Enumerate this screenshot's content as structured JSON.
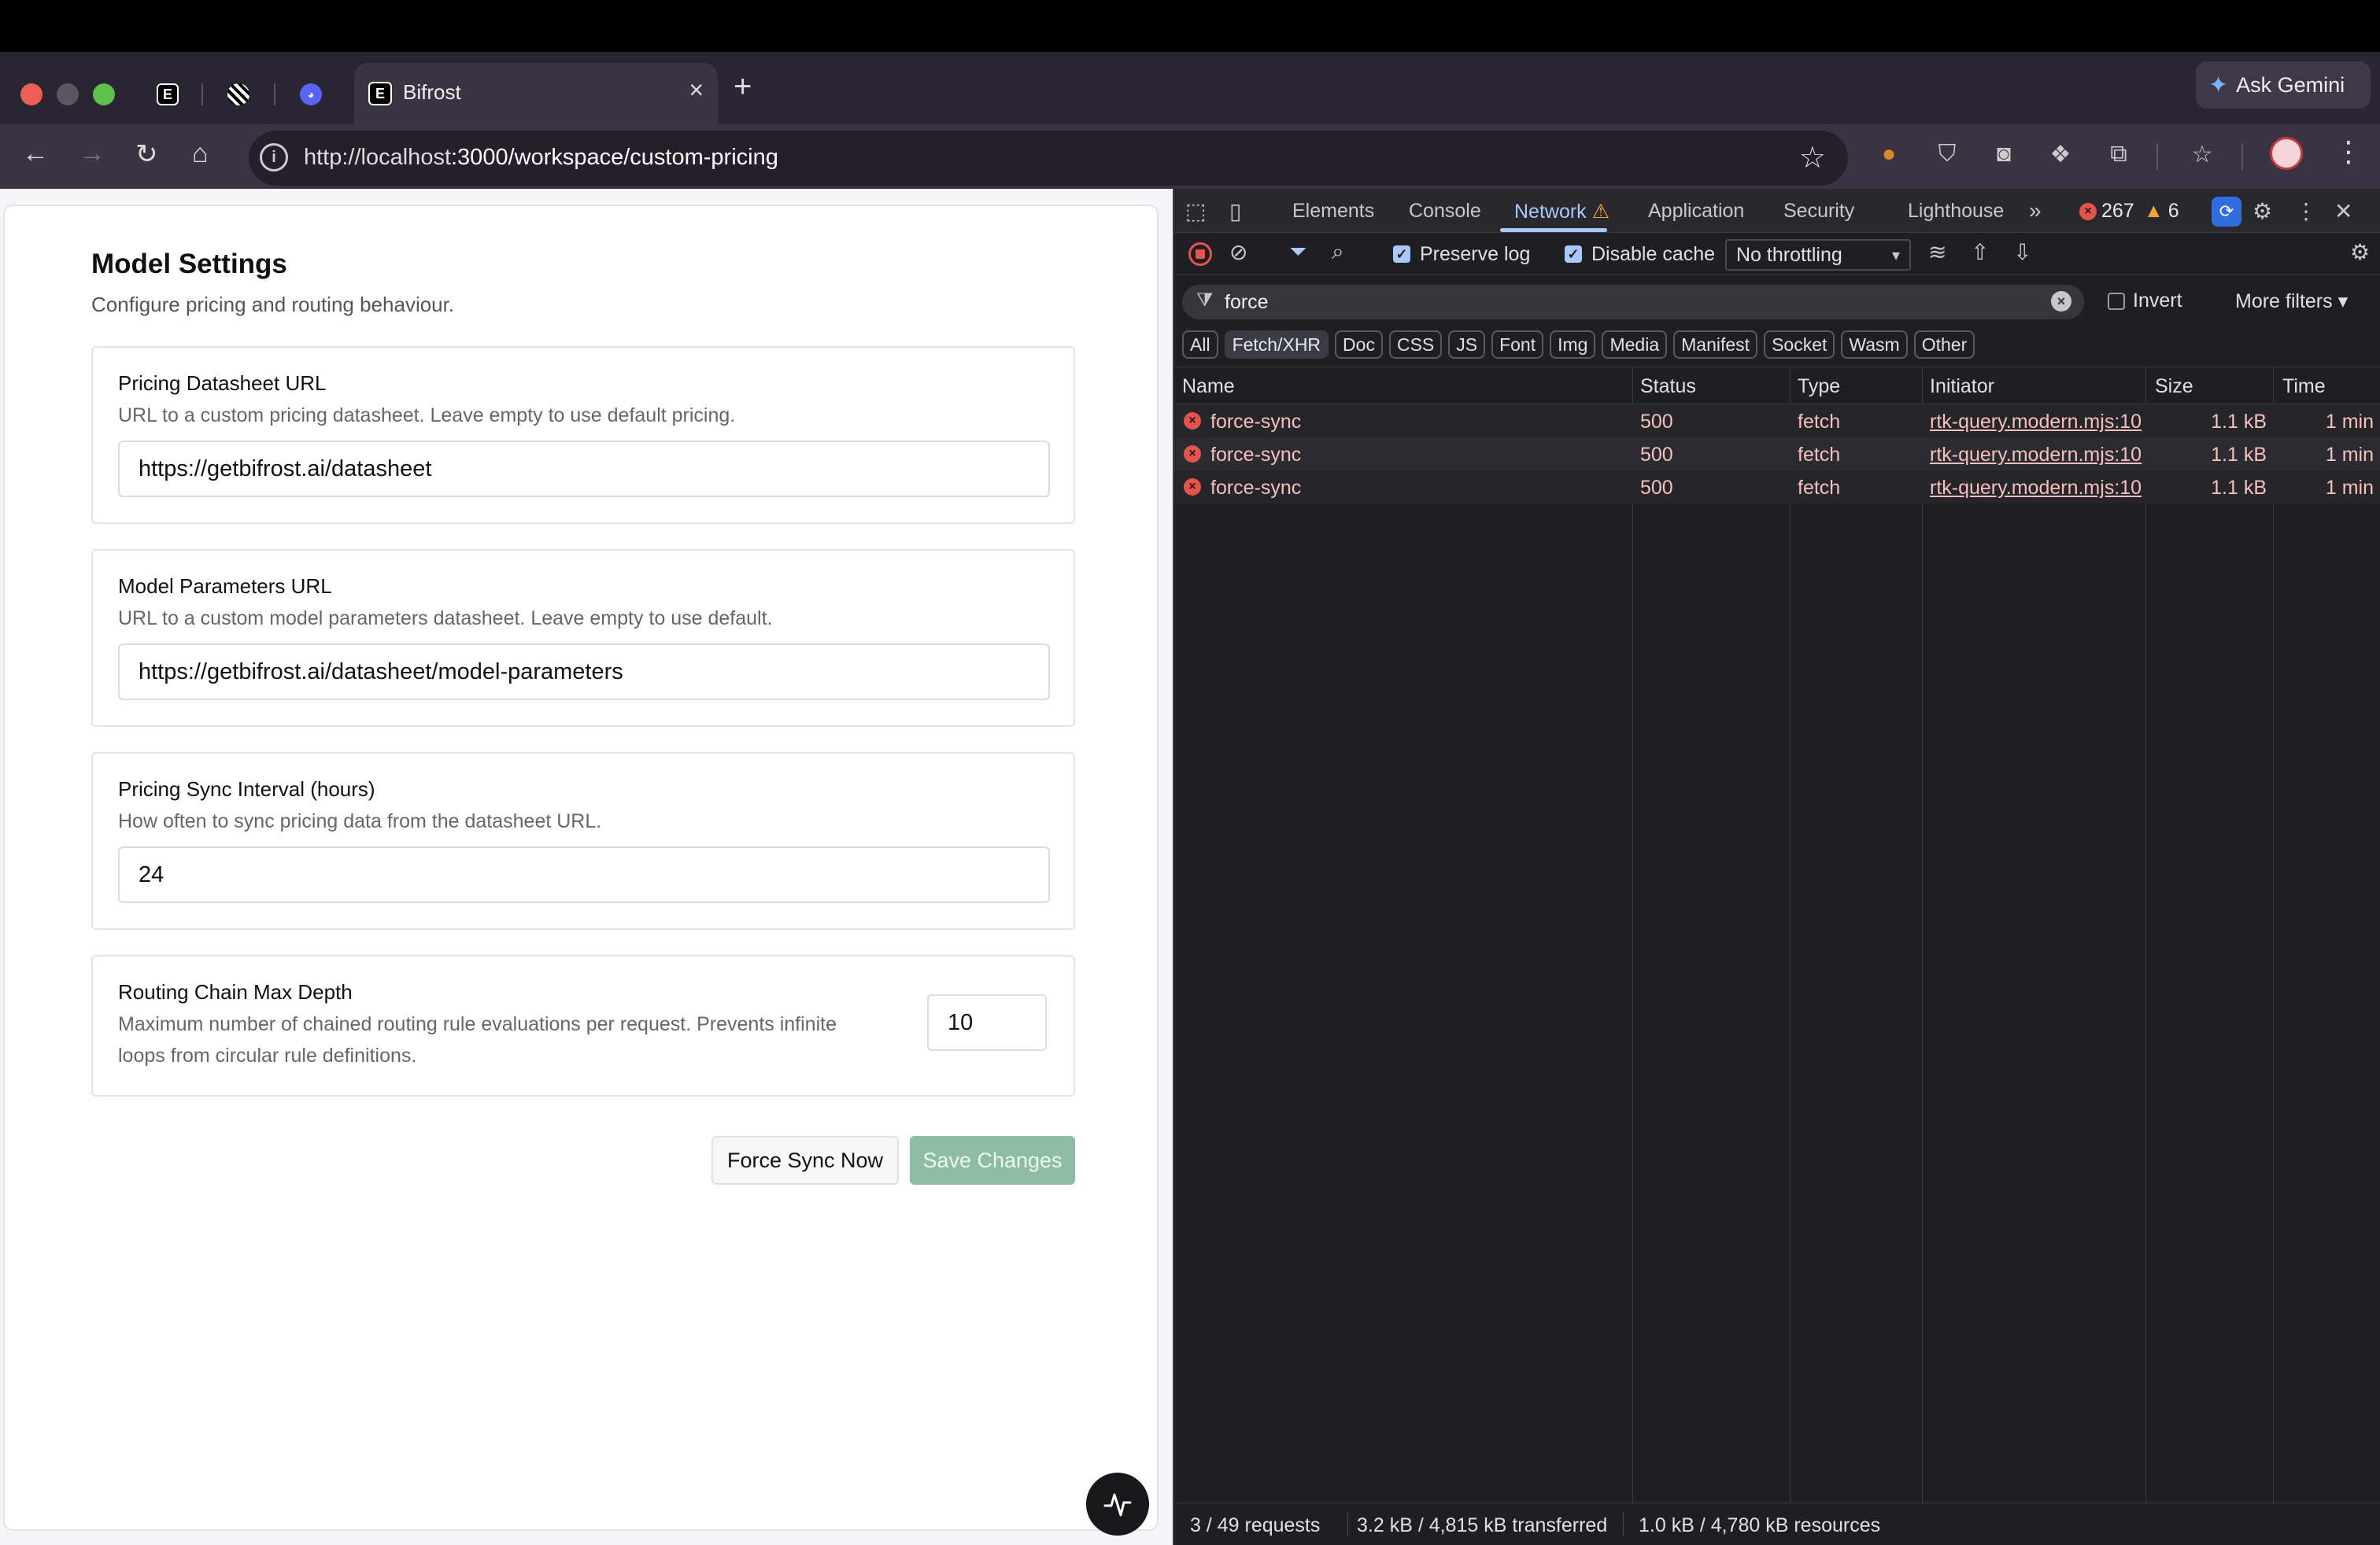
{
  "browser": {
    "active_tab_title": "Bifrost",
    "tab_favicon_letter": "E",
    "url_host": "http://localhost",
    "url_rest": ":3000/workspace/custom-pricing",
    "ask_gemini": "Ask Gemini"
  },
  "page": {
    "title": "Model Settings",
    "description": "Configure pricing and routing behaviour.",
    "cards": [
      {
        "label": "Pricing Datasheet URL",
        "help": "URL to a custom pricing datasheet. Leave empty to use default pricing.",
        "value": "https://getbifrost.ai/datasheet"
      },
      {
        "label": "Model Parameters URL",
        "help": "URL to a custom model parameters datasheet. Leave empty to use default.",
        "value": "https://getbifrost.ai/datasheet/model-parameters"
      },
      {
        "label": "Pricing Sync Interval (hours)",
        "help": "How often to sync pricing data from the datasheet URL.",
        "value": "24"
      },
      {
        "label": "Routing Chain Max Depth",
        "help_line1": "Maximum number of chained routing rule evaluations per request. Prevents infinite",
        "help_line2": "loops from circular rule definitions.",
        "value": "10"
      }
    ],
    "force_sync_label": "Force Sync Now",
    "save_label": "Save Changes"
  },
  "devtools": {
    "tabs": [
      "Elements",
      "Console",
      "Network",
      "Application",
      "Security",
      "Lighthouse"
    ],
    "error_count": "267",
    "warning_count": "6",
    "preserve_log": "Preserve log",
    "disable_cache": "Disable cache",
    "throttling": "No throttling",
    "filter_text": "force",
    "invert": "Invert",
    "more_filters": "More filters",
    "type_filters": [
      "All",
      "Fetch/XHR",
      "Doc",
      "CSS",
      "JS",
      "Font",
      "Img",
      "Media",
      "Manifest",
      "Socket",
      "Wasm",
      "Other"
    ],
    "columns": [
      "Name",
      "Status",
      "Type",
      "Initiator",
      "Size",
      "Time"
    ],
    "rows": [
      {
        "name": "force-sync",
        "status": "500",
        "type": "fetch",
        "initiator": "rtk-query.modern.mjs:10",
        "size": "1.1 kB",
        "time": "1 min"
      },
      {
        "name": "force-sync",
        "status": "500",
        "type": "fetch",
        "initiator": "rtk-query.modern.mjs:10",
        "size": "1.1 kB",
        "time": "1 min"
      },
      {
        "name": "force-sync",
        "status": "500",
        "type": "fetch",
        "initiator": "rtk-query.modern.mjs:10",
        "size": "1.1 kB",
        "time": "1 min"
      }
    ],
    "status_requests": "3 / 49 requests",
    "status_transferred": "3.2 kB / 4,815 kB transferred",
    "status_resources": "1.0 kB / 4,780 kB resources"
  }
}
